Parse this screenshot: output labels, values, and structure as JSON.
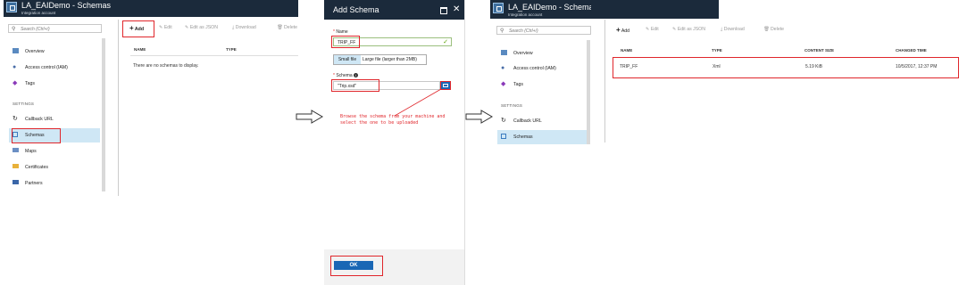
{
  "panel1": {
    "title": "LA_EAIDemo - Schemas",
    "subtitle": "Integration account",
    "search_placeholder": "Search (Ctrl+/)",
    "nav": {
      "overview": "Overview",
      "access_control": "Access control (IAM)",
      "tags": "Tags",
      "settings_header": "SETTINGS",
      "callback_url": "Callback URL",
      "schemas": "Schemas",
      "maps": "Maps",
      "certificates": "Certificates",
      "partners": "Partners"
    },
    "toolbar": {
      "add": "Add",
      "edit": "Edit",
      "edit_json": "Edit as JSON",
      "download": "Download",
      "delete": "Delete"
    },
    "table": {
      "col_name": "NAME",
      "col_type": "TYPE",
      "empty": "There are no schemas to display."
    }
  },
  "dialog": {
    "title": "Add Schema",
    "name_label": "Name",
    "name_value": "TRIP_FF",
    "toggle_small": "Small file",
    "toggle_large": "Large file (larger than 2MB)",
    "schema_label": "Schema",
    "schema_value": "\"Trip.xsd\"",
    "ok": "OK"
  },
  "note": {
    "line1": "Browse the schema from your machine and",
    "line2": "select the one to be uploaded"
  },
  "panel3": {
    "title": "LA_EAIDemo - Schemas",
    "subtitle": "Integration account",
    "search_placeholder": "Search (Ctrl+/)",
    "nav": {
      "overview": "Overview",
      "access_control": "Access control (IAM)",
      "tags": "Tags",
      "settings_header": "SETTINGS",
      "callback_url": "Callback URL",
      "schemas": "Schemas"
    },
    "toolbar": {
      "add": "Add",
      "edit": "Edit",
      "edit_json": "Edit as JSON",
      "download": "Download",
      "delete": "Delete"
    },
    "table": {
      "col_name": "NAME",
      "col_type": "TYPE",
      "col_size": "CONTENT SIZE",
      "col_changed": "CHANGED TIME",
      "rows": [
        {
          "name": "TRIP_FF",
          "type": "Xml",
          "size": "5.19 KiB",
          "changed": "10/5/2017, 12:37 PM"
        }
      ]
    }
  },
  "colors": {
    "titlebar": "#1b2a3b",
    "accent": "#1a67b5",
    "highlight": "#e0262b",
    "selected": "#cfe7f5"
  }
}
